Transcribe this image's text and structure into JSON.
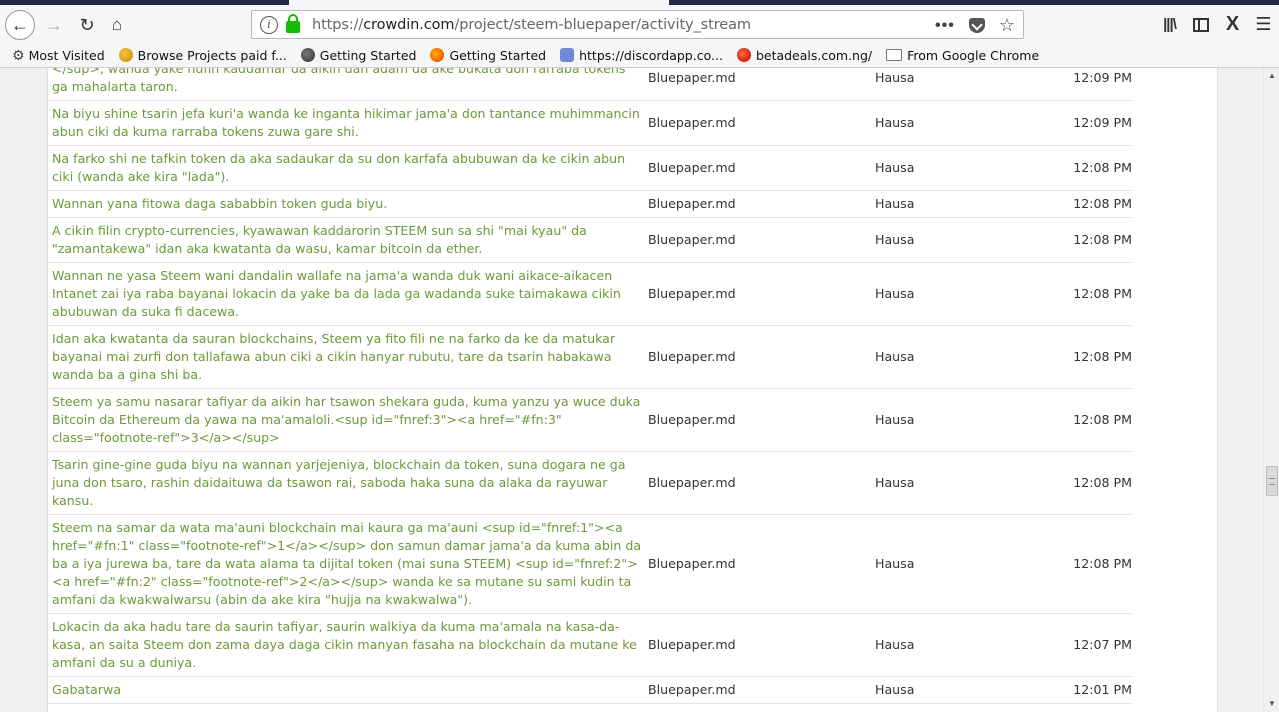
{
  "browser": {
    "url_protocol": "https://",
    "url_host": "crowdin.com",
    "url_path": "/project/steem-bluepaper/activity_stream",
    "bookmarks": [
      {
        "label": "Most Visited",
        "icon": "gear-icon"
      },
      {
        "label": "Browse Projects paid f...",
        "icon": "bulb-icon"
      },
      {
        "label": "Getting Started",
        "icon": "globe-icon"
      },
      {
        "label": "Getting Started",
        "icon": "firefox-icon"
      },
      {
        "label": "https://discordapp.co...",
        "icon": "discord-icon"
      },
      {
        "label": "betadeals.com.ng/",
        "icon": "betadeals-icon"
      },
      {
        "label": "From Google Chrome",
        "icon": "folder-icon"
      }
    ]
  },
  "activity": {
    "text_color": "#6b9a3a",
    "rows": [
      {
        "text": "</sup>, wanda yake nufin kaddamar da aikin dan adam da ake bukata don rarraba tokens ga mahalarta taron.",
        "file": "Bluepaper.md",
        "language": "Hausa",
        "time": "12:09 PM"
      },
      {
        "text": "Na biyu shine tsarin jefa kuri'a wanda ke inganta hikimar jama'a don tantance muhimmancin abun ciki da kuma rarraba tokens zuwa gare shi.",
        "file": "Bluepaper.md",
        "language": "Hausa",
        "time": "12:09 PM"
      },
      {
        "text": "Na farko shi ne tafkin token da aka sadaukar da su don karfafa abubuwan da ke cikin abun ciki (wanda ake kira \"lada\").",
        "file": "Bluepaper.md",
        "language": "Hausa",
        "time": "12:08 PM"
      },
      {
        "text": "Wannan yana fitowa daga sababbin token guda biyu.",
        "file": "Bluepaper.md",
        "language": "Hausa",
        "time": "12:08 PM"
      },
      {
        "text": "A cikin filin crypto-currencies, kyawawan kaddarorin STEEM sun sa shi \"mai kyau\" da \"zamantakewa\" idan aka kwatanta da wasu, kamar bitcoin da ether.",
        "file": "Bluepaper.md",
        "language": "Hausa",
        "time": "12:08 PM"
      },
      {
        "text": "Wannan ne yasa Steem wani dandalin wallafe na jama'a wanda duk wani aikace-aikacen Intanet zai iya raba bayanai lokacin da yake ba da lada ga wadanda suke taimakawa cikin abubuwan da suka fi dacewa.",
        "file": "Bluepaper.md",
        "language": "Hausa",
        "time": "12:08 PM"
      },
      {
        "text": "Idan aka kwatanta da sauran blockchains, Steem ya fito fili ne na farko da ke da matukar bayanai mai zurfi don tallafawa abun ciki a cikin hanyar rubutu, tare da tsarin habakawa wanda ba a gina shi ba.",
        "file": "Bluepaper.md",
        "language": "Hausa",
        "time": "12:08 PM"
      },
      {
        "text": "Steem ya samu nasarar tafiyar da aikin har tsawon shekara guda, kuma yanzu ya wuce duka Bitcoin da Ethereum da yawa na ma'amaloli.<sup id=\"fnref:3\"><a href=\"#fn:3\" class=\"footnote-ref\">3</a></sup>",
        "file": "Bluepaper.md",
        "language": "Hausa",
        "time": "12:08 PM"
      },
      {
        "text": "Tsarin gine-gine guda biyu na wannan yarjejeniya, blockchain da token, suna dogara ne ga juna don tsaro, rashin daidaituwa da tsawon rai, saboda haka suna da alaka da rayuwar kansu.",
        "file": "Bluepaper.md",
        "language": "Hausa",
        "time": "12:08 PM"
      },
      {
        "text": "Steem na samar da wata ma'auni blockchain mai kaura ga ma'auni <sup id=\"fnref:1\"><a href=\"#fn:1\" class=\"footnote-ref\">1</a></sup> don samun damar jama'a da kuma abin da ba a iya jurewa ba, tare da wata alama ta dijital token (mai suna STEEM) <sup id=\"fnref:2\"><a href=\"#fn:2\" class=\"footnote-ref\">2</a></sup> wanda ke sa mutane su sami kudin ta amfani da kwakwalwarsu (abin da ake kira \"hujja na kwakwalwa\").",
        "file": "Bluepaper.md",
        "language": "Hausa",
        "time": "12:08 PM"
      },
      {
        "text": "Lokacin da aka hadu tare da saurin tafiyar, saurin walkiya da kuma ma'amala na kasa-da-kasa, an saita Steem don zama daya daga cikin manyan fasaha na blockchain da mutane ke amfani da su a duniya.",
        "file": "Bluepaper.md",
        "language": "Hausa",
        "time": "12:07 PM"
      },
      {
        "text": "Gabatarwa",
        "file": "Bluepaper.md",
        "language": "Hausa",
        "time": "12:01 PM"
      }
    ]
  }
}
